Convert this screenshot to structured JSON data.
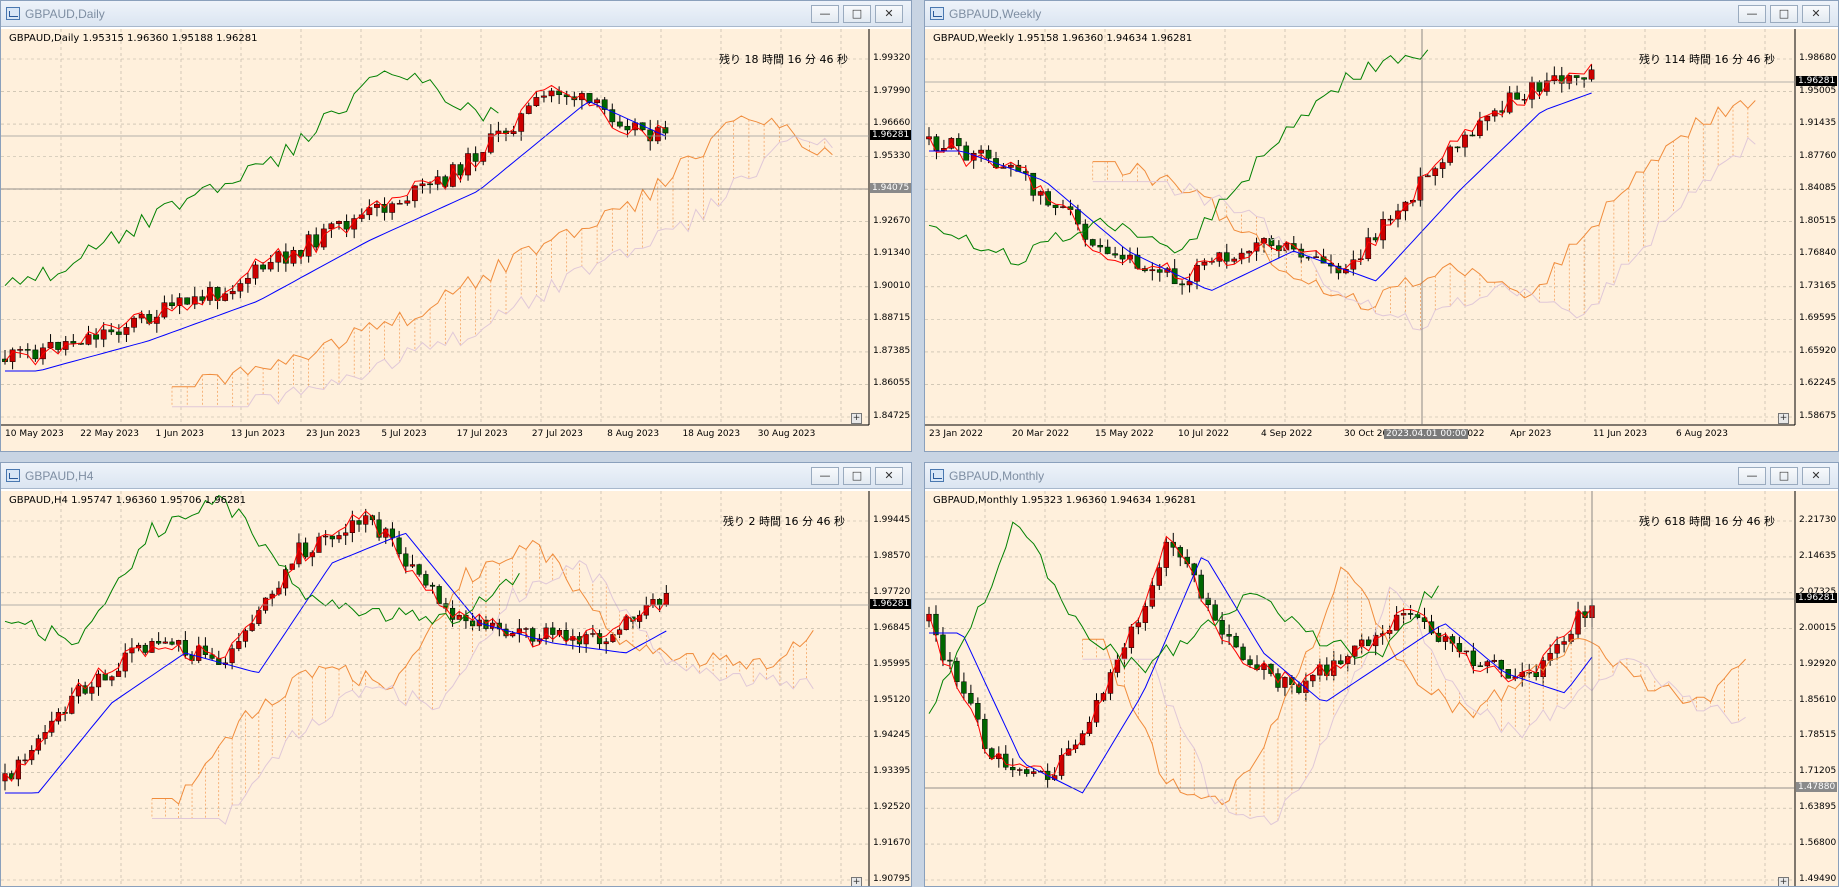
{
  "colors": {
    "bg": "#fff0dc",
    "grid": "#b7b0a0",
    "bull": "#cc0000",
    "bear": "#006600",
    "tenkan": "#ff0000",
    "kijun": "#0000ff",
    "chikou": "#008000",
    "spanA": "#f08c3c",
    "spanB": "#e0c8d8"
  },
  "windows": [
    {
      "id": "daily",
      "title": "GBPAUD,Daily",
      "info": "GBPAUD,Daily  1.95315 1.96360 1.95188 1.96281",
      "timer": "残り 18 時間 16 分 46 秒",
      "price_ticks": [
        "1.99320",
        "1.97990",
        "1.96660",
        "1.95330",
        "1.94000",
        "1.92670",
        "1.91340",
        "1.90010",
        "1.88715",
        "1.87385",
        "1.86055",
        "1.84725"
      ],
      "time_ticks": [
        "10 May 2023",
        "22 May 2023",
        "1 Jun 2023",
        "13 Jun 2023",
        "23 Jun 2023",
        "5 Jul 2023",
        "17 Jul 2023",
        "27 Jul 2023",
        "8 Aug 2023",
        "18 Aug 2023",
        "30 Aug 2023"
      ],
      "badges": [
        {
          "label": "1.96281",
          "style": "bid"
        },
        {
          "label": "1.94075",
          "style": "line"
        }
      ]
    },
    {
      "id": "weekly",
      "title": "GBPAUD,Weekly",
      "info": "GBPAUD,Weekly  1.95158 1.96360 1.94634 1.96281",
      "timer": "残り 114 時間 16 分 46 秒",
      "price_ticks": [
        "1.98680",
        "1.95005",
        "1.91435",
        "1.87760",
        "1.84085",
        "1.80515",
        "1.76840",
        "1.73165",
        "1.69595",
        "1.65920",
        "1.62245",
        "1.58675"
      ],
      "time_ticks": [
        "23 Jan 2022",
        "20 Mar 2022",
        "15 May 2022",
        "10 Jul 2022",
        "4 Sep 2022",
        "30 Oct 2022",
        "25 Dec 2022",
        "Apr 2023",
        "11 Jun 2023",
        "6 Aug 2023"
      ],
      "badges": [
        {
          "label": "1.96281",
          "style": "bid"
        },
        {
          "label": "2023.04.01 00:00",
          "style": "cross"
        }
      ]
    },
    {
      "id": "h4",
      "title": "GBPAUD,H4",
      "info": "GBPAUD,H4  1.95747 1.96360 1.95706 1.96281",
      "timer": "残り 2 時間 16 分 46 秒",
      "price_ticks": [
        "1.99445",
        "1.98570",
        "1.97720",
        "1.96845",
        "1.95995",
        "1.95120",
        "1.94245",
        "1.93395",
        "1.92520",
        "1.91670",
        "1.90795"
      ],
      "time_ticks": [],
      "badges": [
        {
          "label": "1.96281",
          "style": "bid"
        }
      ]
    },
    {
      "id": "monthly",
      "title": "GBPAUD,Monthly",
      "info": "GBPAUD,Monthly  1.95323 1.96360 1.94634 1.96281",
      "timer": "残り 618 時間 16 分 46 秒",
      "price_ticks": [
        "2.21730",
        "2.14635",
        "2.07325",
        "2.00015",
        "1.92920",
        "1.85610",
        "1.78515",
        "1.71205",
        "1.63895",
        "1.56800",
        "1.49490"
      ],
      "time_ticks": [],
      "badges": [
        {
          "label": "1.96281",
          "style": "bid"
        },
        {
          "label": "1.47880",
          "style": "line"
        }
      ]
    }
  ]
}
